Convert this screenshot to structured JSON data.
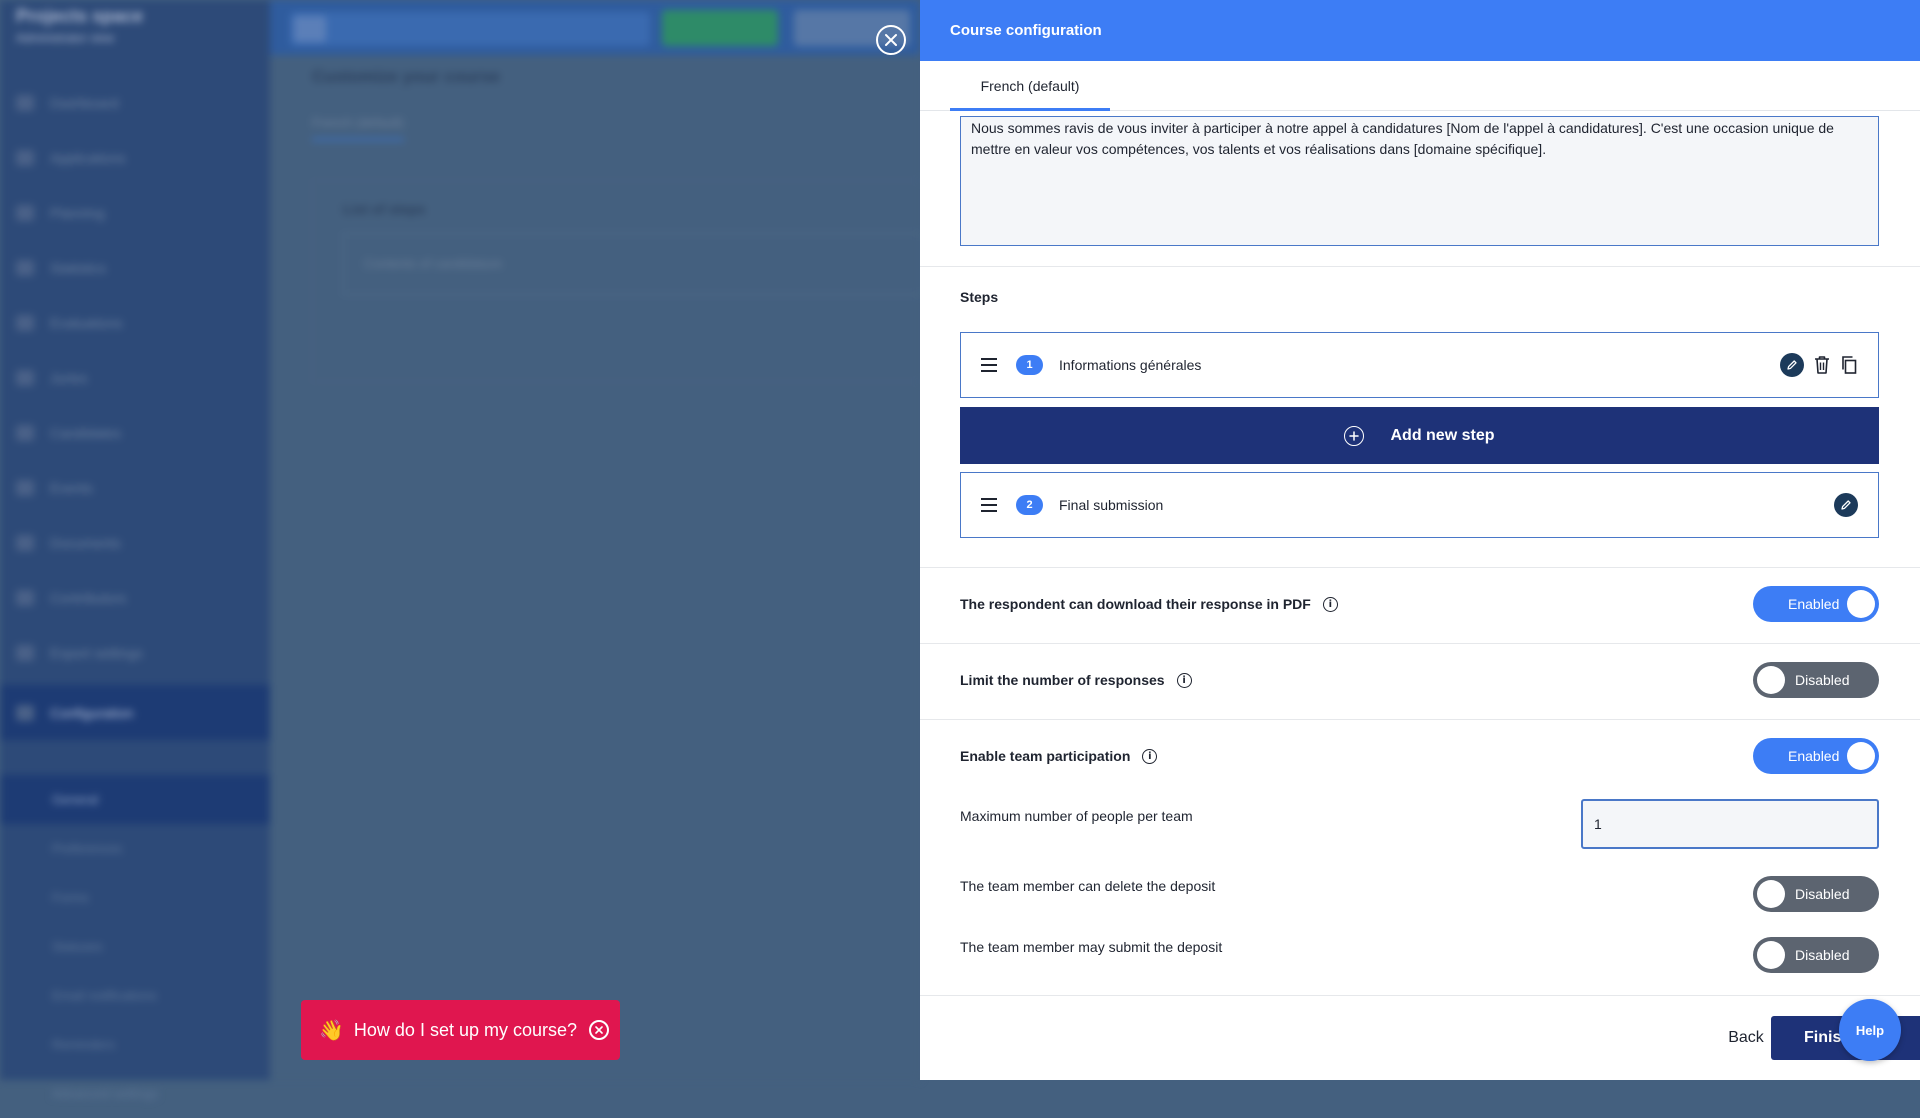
{
  "panel": {
    "title": "Course configuration",
    "tab_label": "French (default)",
    "description_text": "Nous sommes ravis de vous inviter à participer à notre appel à candidatures [Nom de l'appel à candidatures]. C'est une occasion unique de mettre en valeur vos compétences, vos talents et vos réalisations dans [domaine spécifique].",
    "steps_label": "Steps",
    "steps": [
      {
        "number": "1",
        "name": "Informations générales"
      },
      {
        "number": "2",
        "name": "Final submission"
      }
    ],
    "add_step_label": "Add new step",
    "options": {
      "pdf": {
        "label": "The respondent can download their response in PDF",
        "state": "Enabled"
      },
      "limit": {
        "label": "Limit the number of responses",
        "state": "Disabled"
      },
      "team": {
        "label": "Enable team participation",
        "state": "Enabled"
      },
      "max_people": {
        "label": "Maximum number of people per team",
        "value": "1"
      },
      "delete_deposit": {
        "label": "The team member can delete the deposit",
        "state": "Disabled"
      },
      "submit_deposit": {
        "label": "The team member may submit the deposit",
        "state": "Disabled"
      }
    },
    "back_label": "Back",
    "finish_label": "Finish"
  },
  "help_prompt": {
    "text": "How do I set up my course?"
  },
  "help_fab_label": "Help",
  "colors": {
    "accent": "#3d7df5",
    "navy": "#1e3278",
    "toggle_off": "#5c6470",
    "help_pill": "#e0164f"
  }
}
